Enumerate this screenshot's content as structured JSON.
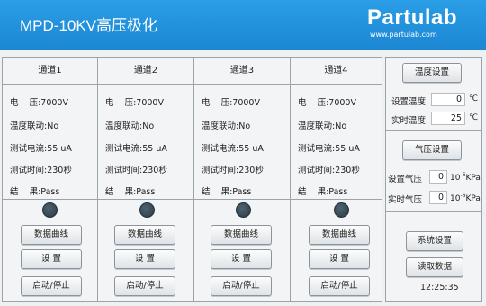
{
  "header": {
    "title": "MPD-10KV高压极化",
    "brand": "Partulab",
    "site": "www.partulab.com"
  },
  "channels": [
    {
      "name": "通道1",
      "voltage_label": "电    压",
      "voltage": "7000V",
      "temp_link_label": "温度联动",
      "temp_link": "No",
      "current_label": "测试电流",
      "current": "55 uA",
      "time_label": "测试时间",
      "time": "230秒",
      "result_label": "结    果",
      "result": "Pass",
      "curve_btn": "数据曲线",
      "settings_btn": "设    置",
      "startstop_btn": "启动/停止"
    },
    {
      "name": "通道2",
      "voltage_label": "电    压",
      "voltage": "7000V",
      "temp_link_label": "温度联动",
      "temp_link": "No",
      "current_label": "测试电流",
      "current": "55 uA",
      "time_label": "测试时间",
      "time": "230秒",
      "result_label": "结    果",
      "result": "Pass",
      "curve_btn": "数据曲线",
      "settings_btn": "设    置",
      "startstop_btn": "启动/停止"
    },
    {
      "name": "通道3",
      "voltage_label": "电    压",
      "voltage": "7000V",
      "temp_link_label": "温度联动",
      "temp_link": "No",
      "current_label": "测试电流",
      "current": "55 uA",
      "time_label": "测试时间",
      "time": "230秒",
      "result_label": "结    果",
      "result": "Pass",
      "curve_btn": "数据曲线",
      "settings_btn": "设    置",
      "startstop_btn": "启动/停止"
    },
    {
      "name": "通道4",
      "voltage_label": "电    压",
      "voltage": "7000V",
      "temp_link_label": "温度联动",
      "temp_link": "No",
      "current_label": "测试电流",
      "current": "55 uA",
      "time_label": "测试时间",
      "time": "230秒",
      "result_label": "结    果",
      "result": "Pass",
      "curve_btn": "数据曲线",
      "settings_btn": "设    置",
      "startstop_btn": "启动/停止"
    }
  ],
  "side": {
    "temp_settings_btn": "温度设置",
    "set_temp_label": "设置温度",
    "set_temp_value": "0",
    "temp_unit": "℃",
    "real_temp_label": "实时温度",
    "real_temp_value": "25",
    "pressure_settings_btn": "气压设置",
    "set_pressure_label": "设置气压",
    "set_pressure_value": "0",
    "real_pressure_label": "实时气压",
    "real_pressure_value": "0",
    "pressure_unit_base": "10",
    "pressure_unit_exp": "-6",
    "pressure_unit": "KPa",
    "system_settings_btn": "系统设置",
    "read_data_btn": "读取数据",
    "clock": "12:25:35"
  },
  "colors": {
    "header": "#1c86d3",
    "led": "#3a505c"
  }
}
